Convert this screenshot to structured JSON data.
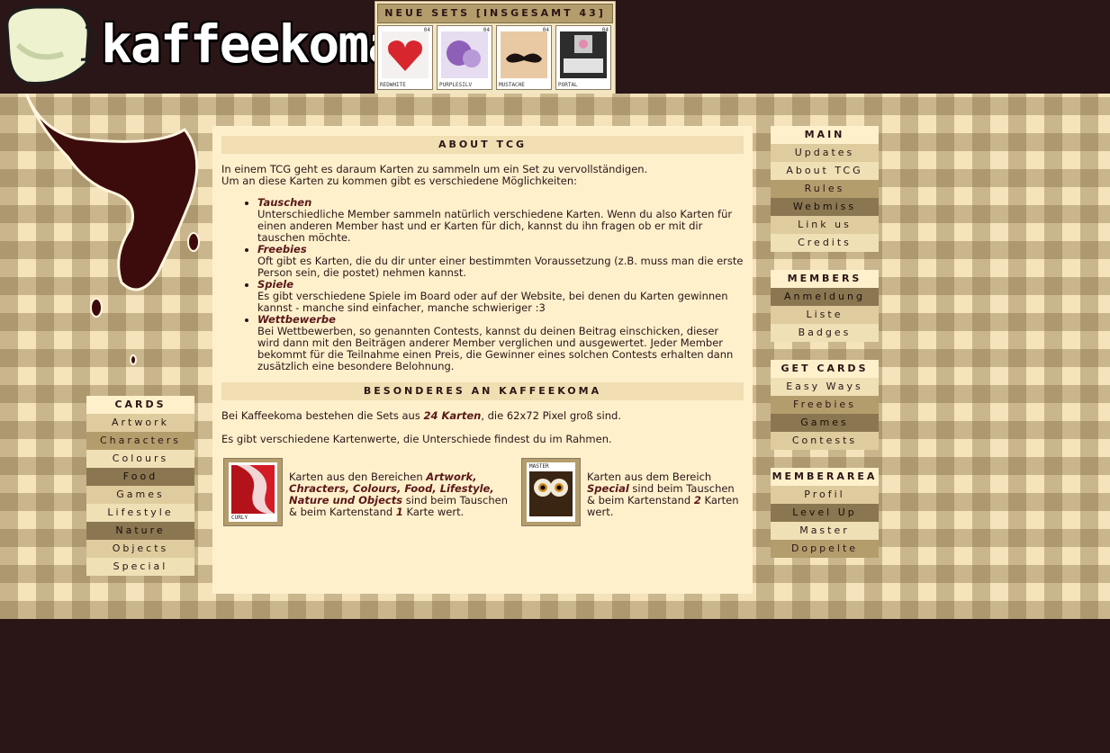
{
  "site": {
    "logo_text": "kaffeekoma"
  },
  "new_sets": {
    "title": "NEUE SETS [INSGESAMT 43]",
    "cards": [
      {
        "name": "REDWHITE",
        "number": "04"
      },
      {
        "name": "PURPLESILV",
        "number": "04"
      },
      {
        "name": "MUSTACHE",
        "number": "04"
      },
      {
        "name": "PORTAL",
        "number": "04"
      }
    ]
  },
  "left_nav": {
    "title": "CARDS",
    "items": [
      "Artwork",
      "Characters",
      "Colours",
      "Food",
      "Games",
      "Lifestyle",
      "Nature",
      "Objects",
      "Special"
    ]
  },
  "right_nav": {
    "sections": [
      {
        "title": "MAIN",
        "items": [
          "Updates",
          "About TCG",
          "Rules",
          "Webmiss",
          "Link us",
          "Credits"
        ]
      },
      {
        "title": "MEMBERS",
        "items": [
          "Anmeldung",
          "Liste",
          "Badges"
        ]
      },
      {
        "title": "GET CARDS",
        "items": [
          "Easy Ways",
          "Freebies",
          "Games",
          "Contests"
        ]
      },
      {
        "title": "MEMBERAREA",
        "items": [
          "Profil",
          "Level Up",
          "Master",
          "Doppelte"
        ]
      }
    ]
  },
  "main": {
    "about_title": "ABOUT TCG",
    "intro_line1": "In einem TCG geht es daraum Karten zu sammeln um ein Set zu vervollständigen.",
    "intro_line2": "Um an diese Karten zu kommen gibt es verschiedene Möglichkeiten:",
    "points": [
      {
        "title": "Tauschen",
        "text": "Unterschiedliche Member sammeln natürlich verschiedene Karten. Wenn du also Karten für einen anderen Member hast und er Karten für dich, kannst du ihn fragen ob er mit dir tauschen möchte."
      },
      {
        "title": "Freebies",
        "text": "Oft gibt es Karten, die du dir unter einer bestimmten Voraussetzung (z.B. muss man die erste Person sein, die postet) nehmen kannst."
      },
      {
        "title": "Spiele",
        "text": "Es gibt verschiedene Spiele im Board oder auf der Website, bei denen du Karten gewinnen kannst - manche sind einfacher, manche schwieriger :3"
      },
      {
        "title": "Wettbewerbe",
        "text": "Bei Wettbewerben, so genannten Contests, kannst du deinen Beitrag einschicken, dieser wird dann mit den Beiträgen anderer Member verglichen und ausgewertet. Jeder Member bekommt für die Teilnahme einen Preis, die Gewinner eines solchen Contests erhalten dann zusätzlich eine besondere Belohnung."
      }
    ],
    "special_title": "BESONDERES AN KAFFEEKOMA",
    "sets_text_before": "Bei Kaffeekoma bestehen die Sets aus ",
    "sets_text_em": "24 Karten",
    "sets_text_after": ", die 62x72 Pixel groß sind.",
    "values_text": "Es gibt verschiedene Kartenwerte, die Unterschiede findest du im Rahmen.",
    "example_left": {
      "card_caption": "CURLY",
      "t1": "Karten aus den Bereichen ",
      "em": "Artwork, Chracters, Colours, Food, Lifestyle, Nature und Objects",
      "t2": " sind beim Tauschen & beim Kartenstand ",
      "em2": "1",
      "t3": " Karte wert."
    },
    "example_right": {
      "card_caption": "MASTER",
      "t1": "Karten aus dem Bereich ",
      "em": "Special",
      "t2": " sind beim Tauschen & beim Kartenstand ",
      "em2": "2",
      "t3": " Karten wert."
    }
  }
}
